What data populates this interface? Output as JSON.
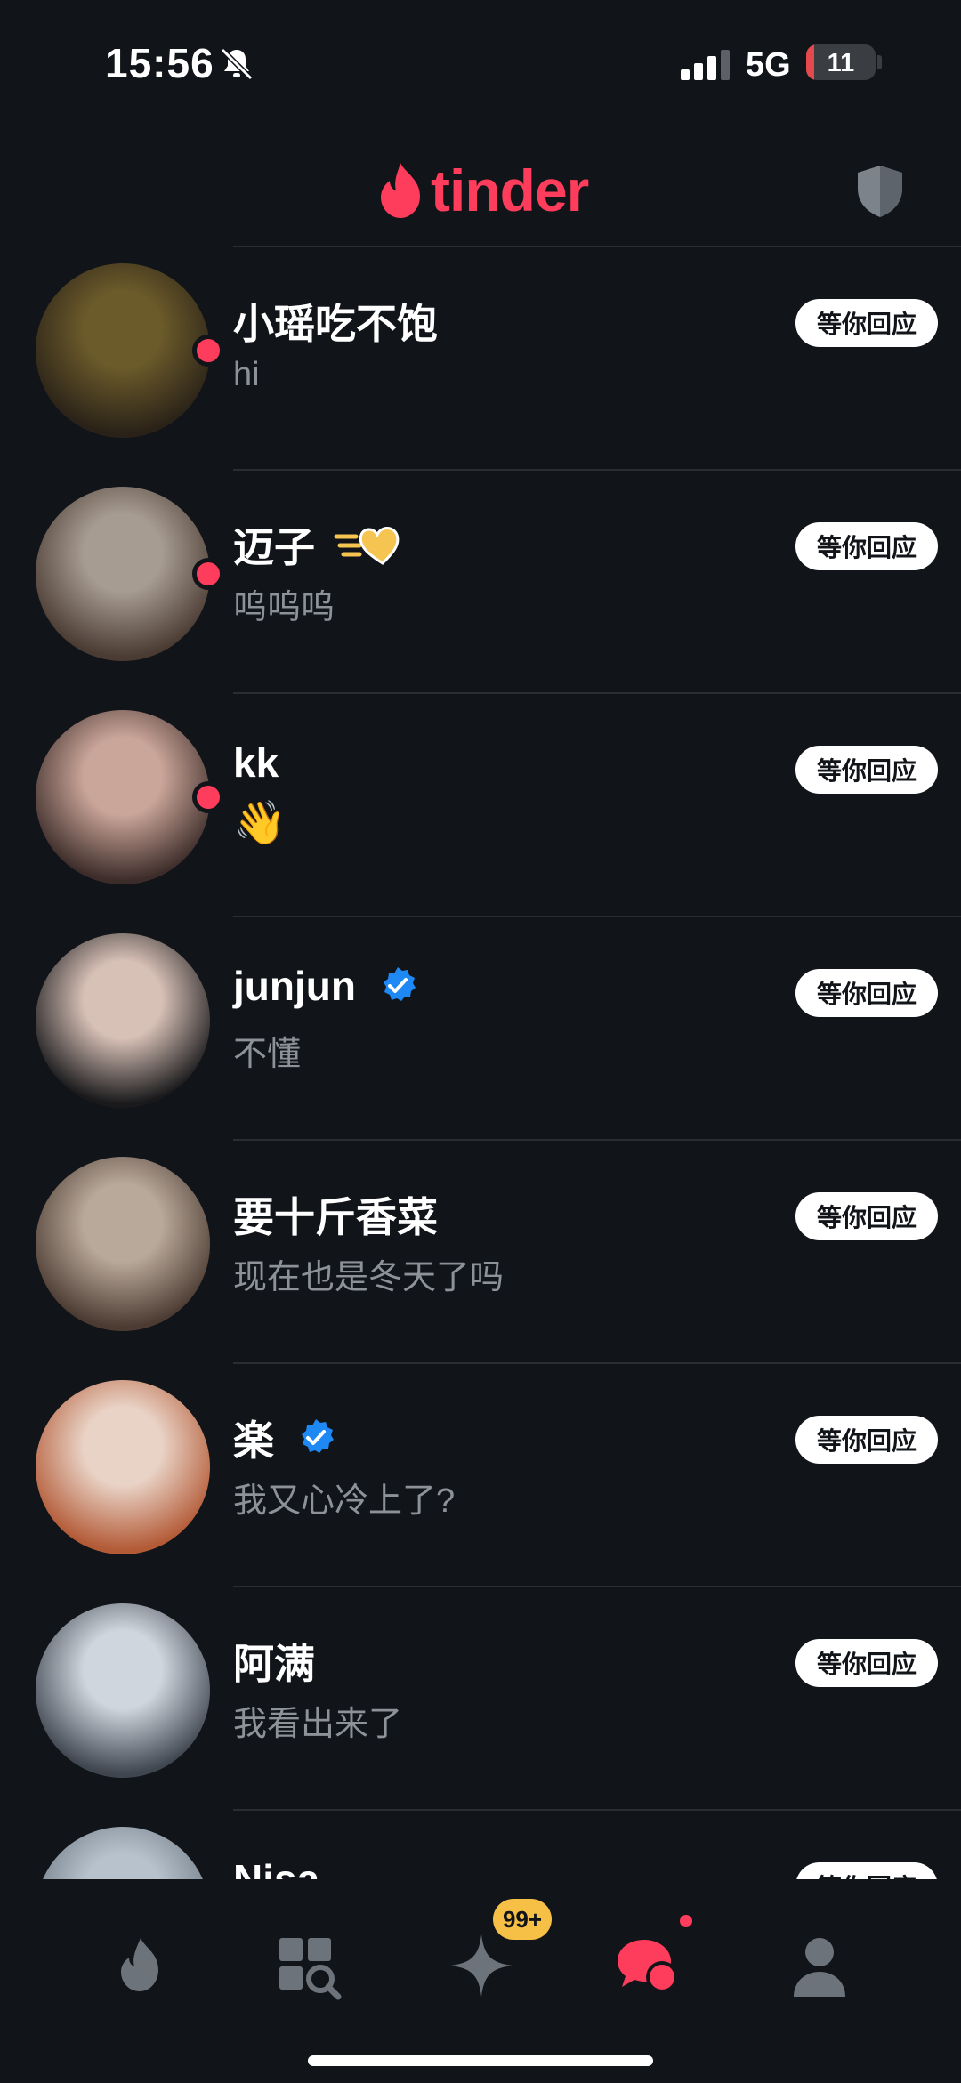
{
  "status_bar": {
    "time": "15:56",
    "network": "5G",
    "battery_level": "11",
    "battery_fraction": 0.11,
    "icons": [
      "bell-off-icon",
      "signal-icon",
      "battery-icon"
    ]
  },
  "header": {
    "logo_text": "tinder",
    "brand_color": "#fe3c5b",
    "icons": [
      "flame-icon",
      "shield-icon"
    ]
  },
  "conversations": [
    {
      "name": "小瑶吃不饱",
      "message": "hi",
      "status": "等你回应",
      "unread": true,
      "verified": false,
      "avatar_colors": [
        "#6b5a2a",
        "#2a2218"
      ]
    },
    {
      "name": "迈子",
      "message": "呜呜呜",
      "status": "等你回应",
      "unread": true,
      "verified": false,
      "badge": "hearts-icon",
      "avatar_colors": [
        "#a79c92",
        "#4a3b33"
      ]
    },
    {
      "name": "kk",
      "message": "👋",
      "status": "等你回应",
      "unread": true,
      "verified": false,
      "avatar_colors": [
        "#caa599",
        "#3d2d2a"
      ]
    },
    {
      "name": "junjun",
      "message": "不懂",
      "status": "等你回应",
      "unread": false,
      "verified": true,
      "avatar_colors": [
        "#d7c0b6",
        "#1a1a1c"
      ]
    },
    {
      "name": "要十斤香菜",
      "message": "现在也是冬天了吗",
      "status": "等你回应",
      "unread": false,
      "verified": false,
      "avatar_colors": [
        "#b9a99a",
        "#4c3b32"
      ]
    },
    {
      "name": "楽",
      "message": "我又心冷上了?",
      "status": "等你回应",
      "unread": false,
      "verified": true,
      "avatar_colors": [
        "#e9d3c6",
        "#b35a36"
      ]
    },
    {
      "name": "阿满",
      "message": "我看出来了",
      "status": "等你回应",
      "unread": false,
      "verified": false,
      "avatar_colors": [
        "#cfd6de",
        "#3f4650"
      ]
    },
    {
      "name": "Nisa",
      "message": "",
      "status": "等你回应",
      "unread": false,
      "verified": false,
      "avatar_colors": [
        "#b8c2cc",
        "#6a7680"
      ]
    }
  ],
  "bottom_nav": {
    "items": [
      "flame-icon",
      "explore-icon",
      "sparkle-icon",
      "chat-icon",
      "profile-icon"
    ],
    "sparkle_badge": "99+",
    "active": "chat-icon"
  }
}
